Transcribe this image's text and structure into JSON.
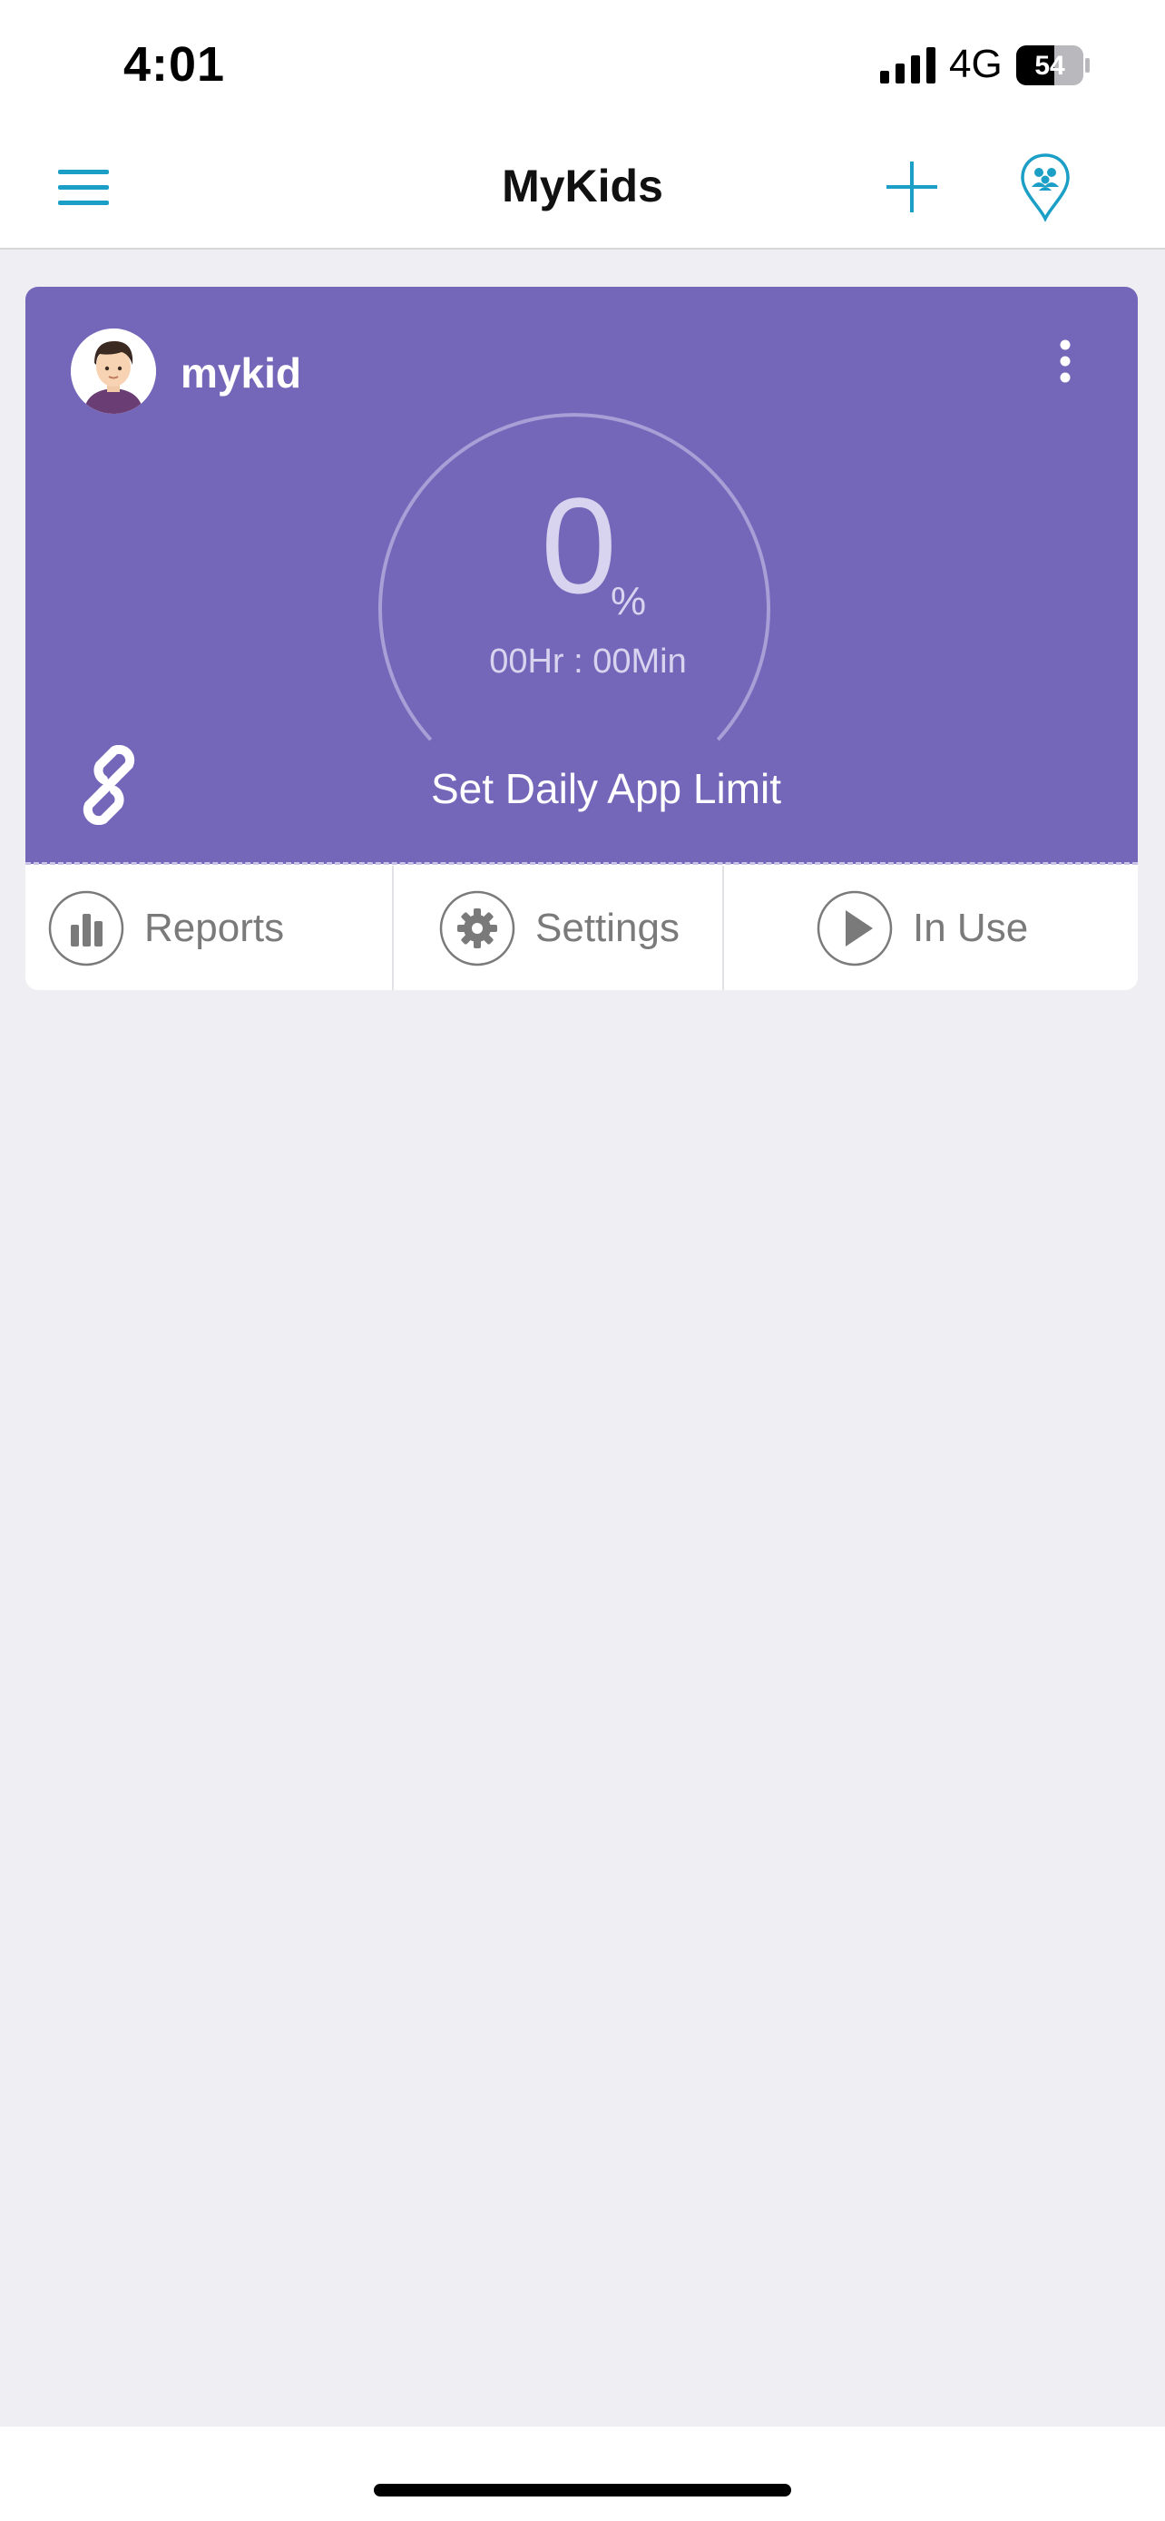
{
  "status_bar": {
    "time": "4:01",
    "network": "4G",
    "battery_level": "54"
  },
  "header": {
    "title": "MyKids",
    "menu_icon": "hamburger-menu-icon",
    "add_icon": "plus-icon",
    "location_icon": "family-location-pin-icon"
  },
  "kid_card": {
    "name": "mykid",
    "avatar_icon": "boy-avatar",
    "more_icon": "vertical-ellipsis-icon",
    "usage_percent": "0",
    "percent_sign": "%",
    "usage_time": "00Hr : 00Min",
    "set_limit_label": "Set Daily App Limit",
    "link_icon": "chain-link-icon"
  },
  "card_actions": [
    {
      "label": "Reports",
      "icon": "bar-chart-icon"
    },
    {
      "label": "Settings",
      "icon": "gear-icon"
    },
    {
      "label": "In Use",
      "icon": "play-icon"
    }
  ],
  "colors": {
    "accent": "#1c9fc6",
    "card_purple": "#7467b9",
    "background": "#efeef3",
    "action_gray": "#7a7a7a"
  }
}
